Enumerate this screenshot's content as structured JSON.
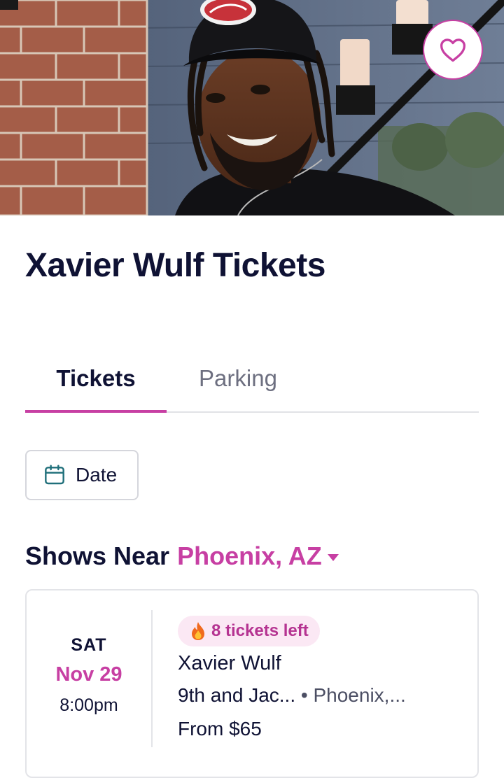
{
  "hero": {
    "image_alt": "Xavier Wulf",
    "favorite_icon": "heart-icon"
  },
  "page": {
    "title": "Xavier Wulf Tickets"
  },
  "tabs": [
    {
      "label": "Tickets",
      "active": true
    },
    {
      "label": "Parking",
      "active": false
    }
  ],
  "filters": {
    "date_icon": "calendar-icon",
    "date_label": "Date"
  },
  "shows": {
    "heading_prefix": "Shows Near",
    "location": "Phoenix, AZ",
    "location_icon": "chevron-down-icon"
  },
  "events": [
    {
      "day_of_week": "SAT",
      "date": "Nov 29",
      "time": "8:00pm",
      "badge_icon": "fire-icon",
      "badge": "8 tickets left",
      "name": "Xavier Wulf",
      "venue": "9th and Jac...",
      "city": "• Phoenix,...",
      "price": "From $65"
    }
  ],
  "colors": {
    "accent": "#c73fa3",
    "text": "#0f1234",
    "muted": "#6d6f80",
    "badge_bg": "#fbe8f4",
    "calendar_icon": "#1f6f7a"
  }
}
